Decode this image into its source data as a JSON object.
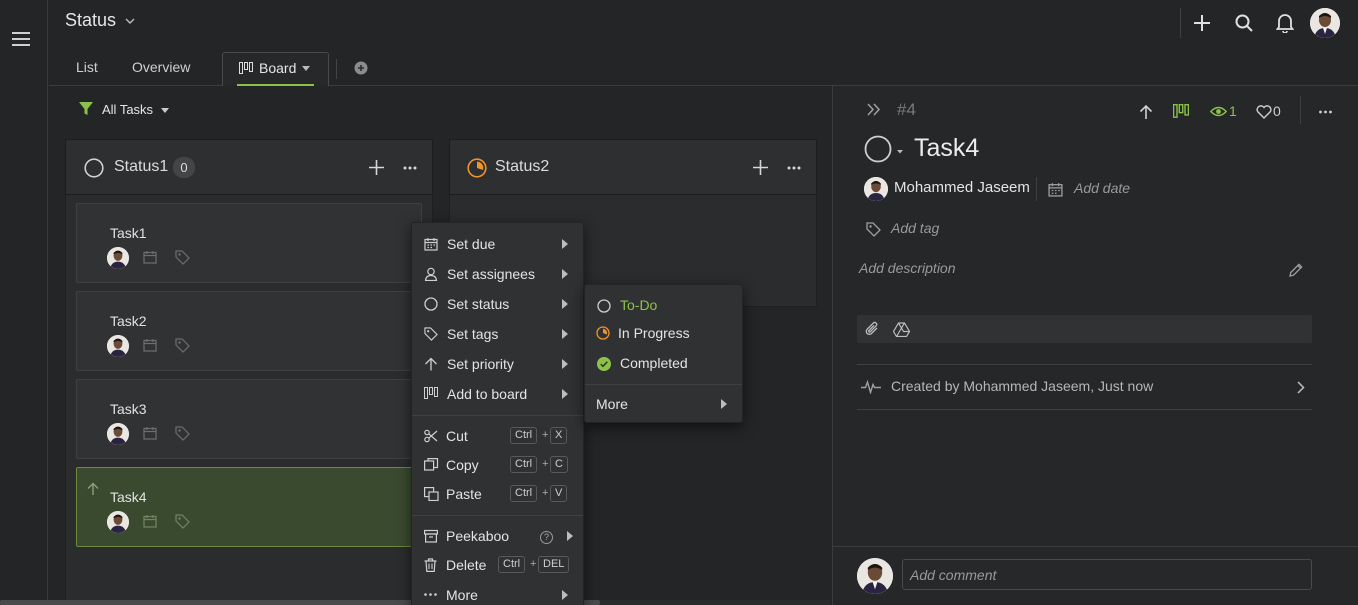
{
  "header": {
    "title": "Status",
    "tabs": [
      {
        "label": "List"
      },
      {
        "label": "Overview"
      },
      {
        "label": "Board"
      }
    ]
  },
  "filter": {
    "label": "All Tasks"
  },
  "columns": [
    {
      "name": "Status1",
      "count": "0"
    },
    {
      "name": "Status2"
    }
  ],
  "cards": [
    {
      "title": "Task1"
    },
    {
      "title": "Task2"
    },
    {
      "title": "Task3"
    },
    {
      "title": "Task4"
    }
  ],
  "context_menu": {
    "items": [
      {
        "label": "Set due"
      },
      {
        "label": "Set assignees"
      },
      {
        "label": "Set status"
      },
      {
        "label": "Set tags"
      },
      {
        "label": "Set priority"
      },
      {
        "label": "Add to board"
      }
    ],
    "cut": {
      "label": "Cut",
      "key1": "Ctrl",
      "plus": "+",
      "key2": "X"
    },
    "copy": {
      "label": "Copy",
      "key1": "Ctrl",
      "plus": "+",
      "key2": "C"
    },
    "paste": {
      "label": "Paste",
      "key1": "Ctrl",
      "plus": "+",
      "key2": "V"
    },
    "peekaboo": {
      "label": "Peekaboo",
      "help": "?"
    },
    "delete": {
      "label": "Delete",
      "key1": "Ctrl",
      "plus": "+",
      "key2": "DEL"
    },
    "more": {
      "label": "More"
    }
  },
  "status_submenu": {
    "items": [
      {
        "label": "To-Do",
        "color": "#8bc34a"
      },
      {
        "label": "In Progress",
        "color": "#e4e4e4"
      },
      {
        "label": "Completed",
        "color": "#e4e4e4"
      }
    ],
    "more": "More"
  },
  "detail": {
    "id": "#4",
    "watchers": "1",
    "likes": "0",
    "task_title": "Task4",
    "assignee": "Mohammed Jaseem",
    "add_date": "Add date",
    "add_tag": "Add tag",
    "add_description": "Add description",
    "activity": "Created by Mohammed Jaseem, Just now",
    "comment_placeholder": "Add comment"
  },
  "colors": {
    "accent_green": "#8bc34a",
    "status_orange": "#f0932b",
    "card_selected_bg": "#3a4a2f"
  }
}
